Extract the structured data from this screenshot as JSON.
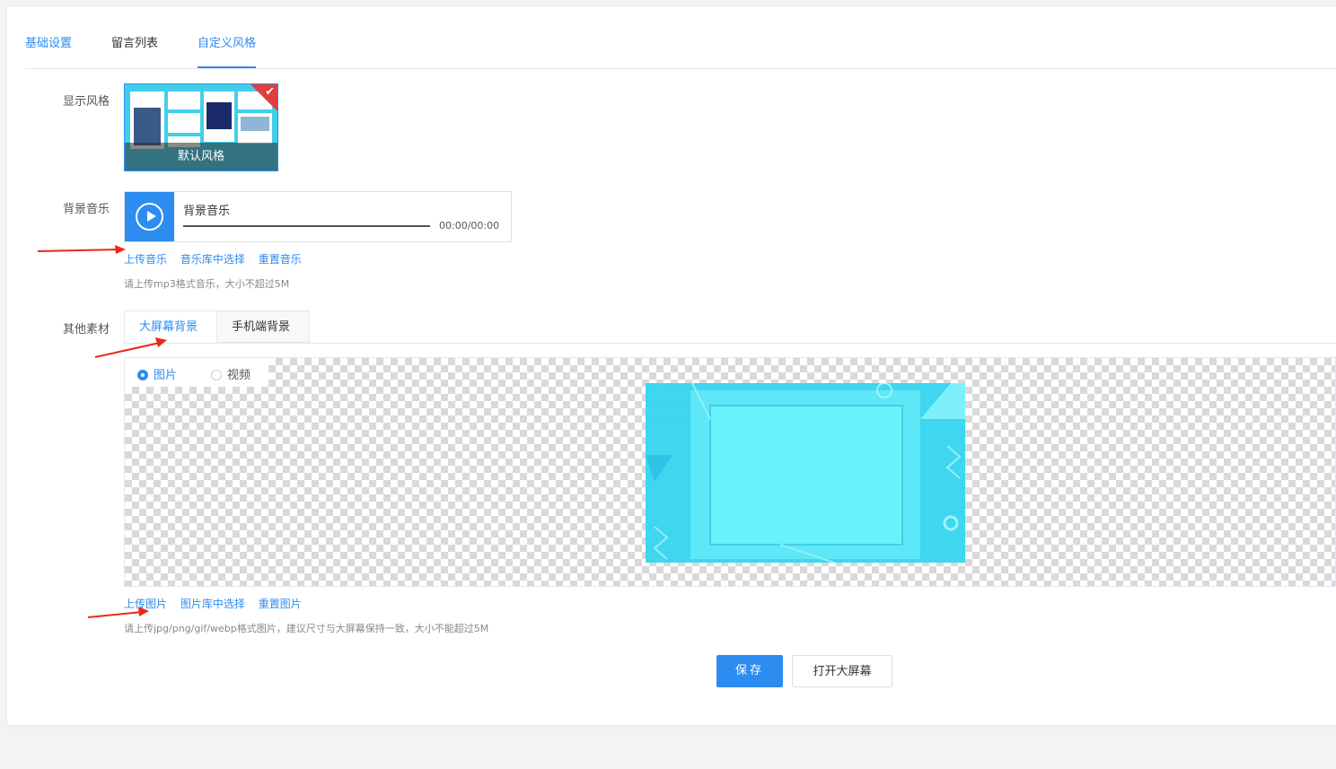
{
  "tabs": [
    {
      "label": "基础设置",
      "active": false
    },
    {
      "label": "留言列表",
      "active": false
    },
    {
      "label": "自定义风格",
      "active": true
    }
  ],
  "display_style": {
    "label": "显示风格",
    "card_name": "默认风格",
    "selected": true
  },
  "music": {
    "label": "背景音乐",
    "player_title": "背景音乐",
    "time": "00:00/00:00",
    "links": [
      "上传音乐",
      "音乐库中选择",
      "重置音乐"
    ],
    "hint": "请上传mp3格式音乐，大小不超过5M"
  },
  "materials": {
    "label": "其他素材",
    "subtabs": [
      {
        "label": "大屏幕背景",
        "active": true
      },
      {
        "label": "手机端背景",
        "active": false
      }
    ],
    "radios": [
      {
        "label": "图片",
        "checked": true
      },
      {
        "label": "视频",
        "checked": false
      }
    ],
    "links": [
      "上传图片",
      "图片库中选择",
      "重置图片"
    ],
    "hint": "请上传jpg/png/gif/webp格式图片，建议尺寸与大屏幕保持一致，大小不能超过5M"
  },
  "buttons": {
    "save": "保存",
    "open_screen": "打开大屏幕"
  },
  "colors": {
    "accent": "#2d8cf0",
    "preview": "#3fd6f0",
    "annotation_arrow": "#e8281e"
  }
}
